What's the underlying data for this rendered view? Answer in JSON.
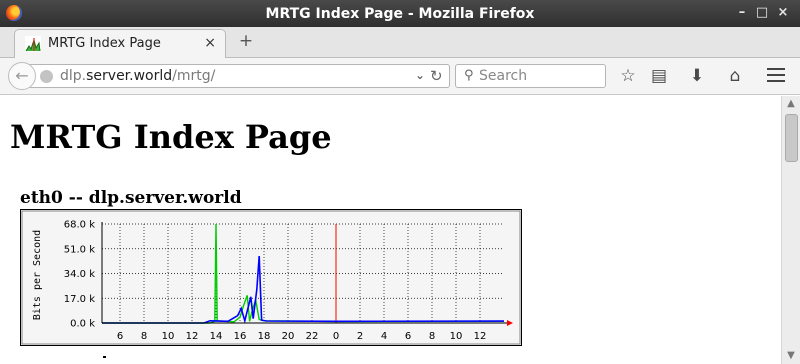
{
  "window": {
    "title": "MRTG Index Page - Mozilla Firefox",
    "minimize_glyph": "–",
    "maximize_glyph": "□",
    "close_glyph": "×"
  },
  "tabs": [
    {
      "label": "MRTG Index Page",
      "close_glyph": "×",
      "icon": "mrtg-graph-icon"
    }
  ],
  "newtab_glyph": "+",
  "navbar": {
    "back_glyph": "←",
    "url_host": "dlp.server.world",
    "url_prefix": "dlp.",
    "url_domain": "server.world",
    "url_path": "/mrtg/",
    "dropdown_glyph": "⌄",
    "reload_glyph": "↻",
    "search_placeholder": "Search",
    "search_glyph": "⚲",
    "bookmark_star_glyph": "☆",
    "reading_list_glyph": "▤",
    "download_glyph": "⬇",
    "home_glyph": "⌂"
  },
  "content": {
    "page_title": "MRTG Index Page",
    "graph_title": "eth0 -- dlp.server.world"
  },
  "scrollbar": {
    "up_glyph": "▲",
    "down_glyph": "▼"
  },
  "colors": {
    "in_traffic": "#00cc00",
    "out_traffic": "#0000ff",
    "now_marker": "#ff0000"
  },
  "chart_data": {
    "type": "area",
    "ylabel": "Bits per Second",
    "ylim": [
      0,
      68000
    ],
    "y_ticks": [
      "0.0 k",
      "17.0 k",
      "34.0 k",
      "51.0 k",
      "68.0 k"
    ],
    "x_ticks": [
      "6",
      "8",
      "10",
      "12",
      "14",
      "16",
      "18",
      "20",
      "22",
      "0",
      "2",
      "4",
      "6",
      "8",
      "10",
      "12"
    ],
    "grid": true,
    "now_marker_hour": 0,
    "series": [
      {
        "kind": "in",
        "color": "#00cc00",
        "points": [
          [
            4.5,
            0
          ],
          [
            13.5,
            0
          ],
          [
            13.9,
            1200
          ],
          [
            14.0,
            68000
          ],
          [
            14.1,
            1500
          ],
          [
            15.5,
            800
          ],
          [
            16.0,
            4000
          ],
          [
            16.3,
            12000
          ],
          [
            16.6,
            19000
          ],
          [
            16.8,
            1200
          ],
          [
            17.0,
            8000
          ],
          [
            17.3,
            16000
          ],
          [
            17.6,
            2500
          ],
          [
            18.0,
            1500
          ],
          [
            24,
            1100
          ],
          [
            38,
            1200
          ]
        ]
      },
      {
        "kind": "out",
        "color": "#0000ff",
        "points": [
          [
            4.5,
            0
          ],
          [
            13.0,
            0
          ],
          [
            13.5,
            1500
          ],
          [
            15.0,
            1200
          ],
          [
            15.8,
            5000
          ],
          [
            16.1,
            10000
          ],
          [
            16.4,
            1500
          ],
          [
            16.9,
            18000
          ],
          [
            17.1,
            3000
          ],
          [
            17.4,
            23000
          ],
          [
            17.6,
            46000
          ],
          [
            17.8,
            2000
          ],
          [
            18.2,
            1400
          ],
          [
            24,
            1200
          ],
          [
            38,
            1300
          ]
        ]
      }
    ]
  }
}
